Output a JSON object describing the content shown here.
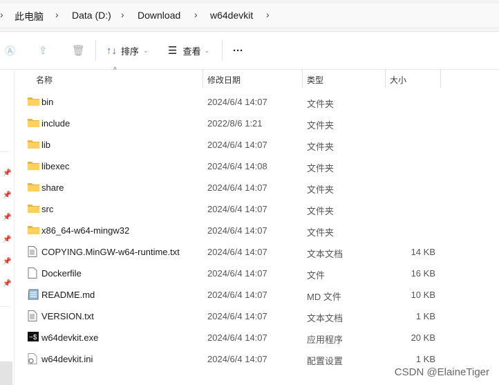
{
  "breadcrumb": [
    "此电脑",
    "Data (D:)",
    "Download",
    "w64devkit"
  ],
  "toolbar": {
    "sort_label": "排序",
    "view_label": "查看",
    "more_label": "···"
  },
  "columns": {
    "name": "名称",
    "modified": "修改日期",
    "type": "类型",
    "size": "大小"
  },
  "files": [
    {
      "name": "bin",
      "modified": "2024/6/4 14:07",
      "type": "文件夹",
      "size": "",
      "icon": "folder-icon"
    },
    {
      "name": "include",
      "modified": "2022/8/6 1:21",
      "type": "文件夹",
      "size": "",
      "icon": "folder-icon"
    },
    {
      "name": "lib",
      "modified": "2024/6/4 14:07",
      "type": "文件夹",
      "size": "",
      "icon": "folder-icon"
    },
    {
      "name": "libexec",
      "modified": "2024/6/4 14:08",
      "type": "文件夹",
      "size": "",
      "icon": "folder-icon"
    },
    {
      "name": "share",
      "modified": "2024/6/4 14:07",
      "type": "文件夹",
      "size": "",
      "icon": "folder-icon"
    },
    {
      "name": "src",
      "modified": "2024/6/4 14:07",
      "type": "文件夹",
      "size": "",
      "icon": "folder-icon"
    },
    {
      "name": "x86_64-w64-mingw32",
      "modified": "2024/6/4 14:07",
      "type": "文件夹",
      "size": "",
      "icon": "folder-icon"
    },
    {
      "name": "COPYING.MinGW-w64-runtime.txt",
      "modified": "2024/6/4 14:07",
      "type": "文本文档",
      "size": "14 KB",
      "icon": "text-file-icon"
    },
    {
      "name": "Dockerfile",
      "modified": "2024/6/4 14:07",
      "type": "文件",
      "size": "16 KB",
      "icon": "file-icon"
    },
    {
      "name": "README.md",
      "modified": "2024/6/4 14:07",
      "type": "MD 文件",
      "size": "10 KB",
      "icon": "markdown-file-icon"
    },
    {
      "name": "VERSION.txt",
      "modified": "2024/6/4 14:07",
      "type": "文本文档",
      "size": "1 KB",
      "icon": "text-file-icon"
    },
    {
      "name": "w64devkit.exe",
      "modified": "2024/6/4 14:07",
      "type": "应用程序",
      "size": "20 KB",
      "icon": "exe-icon"
    },
    {
      "name": "w64devkit.ini",
      "modified": "2024/6/4 14:07",
      "type": "配置设置",
      "size": "1 KB",
      "icon": "ini-file-icon"
    }
  ],
  "watermark": "CSDN @ElaineTiger"
}
